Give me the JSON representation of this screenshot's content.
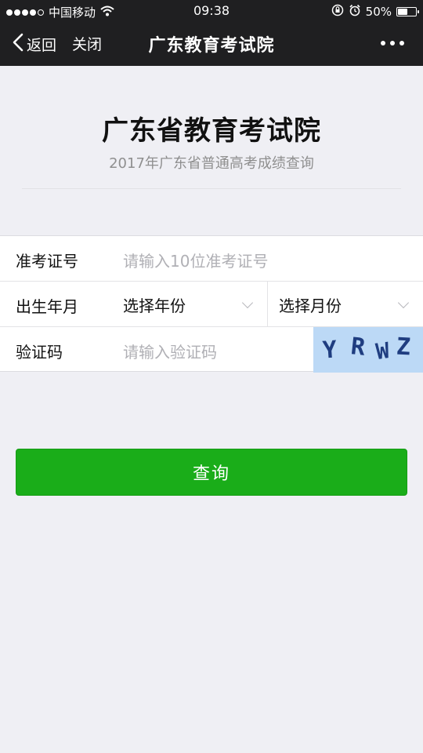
{
  "status_bar": {
    "carrier": "中国移动",
    "time": "09:38",
    "battery": "50%"
  },
  "nav": {
    "back_label": "返回",
    "close_label": "关闭",
    "title": "广东教育考试院"
  },
  "header": {
    "title": "广东省教育考试院",
    "subtitle": "2017年广东省普通高考成绩查询"
  },
  "form": {
    "exam_id": {
      "label": "准考证号",
      "placeholder": "请输入10位准考证号"
    },
    "birth": {
      "label": "出生年月",
      "year": "选择年份",
      "month": "选择月份"
    },
    "captcha": {
      "label": "验证码",
      "placeholder": "请输入验证码",
      "code": [
        "Y",
        "R",
        "W",
        "Z"
      ]
    }
  },
  "submit_label": "查询",
  "colors": {
    "nav_bg": "#1f1f21",
    "page_bg": "#efeff4",
    "button": "#1aad19",
    "captcha_bg": "#bcd9f6"
  }
}
